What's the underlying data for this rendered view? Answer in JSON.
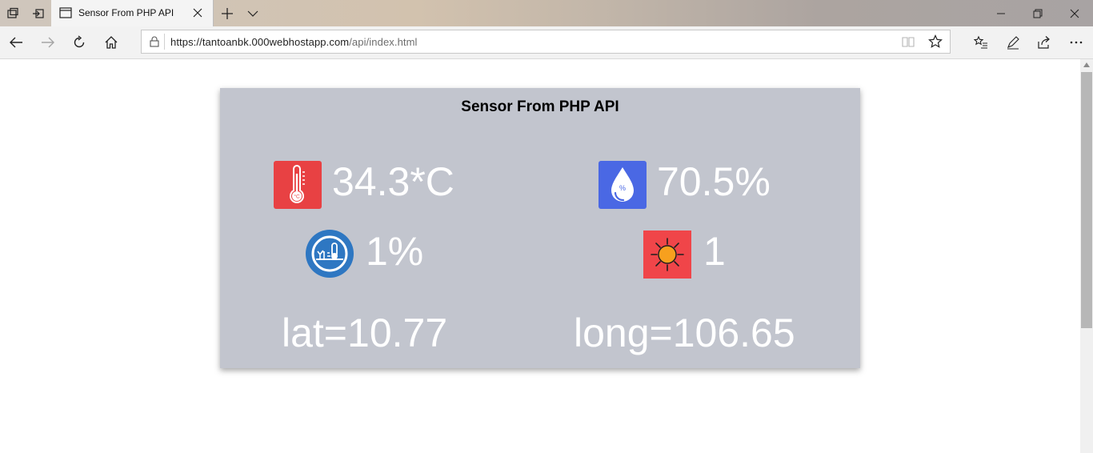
{
  "browser": {
    "tab_title": "Sensor From PHP API",
    "url_host": "https://tantoanbk.000webhostapp.com",
    "url_path": "/api/index.html"
  },
  "card": {
    "title": "Sensor From PHP API",
    "temperature": {
      "value": "34.3*C",
      "icon": "thermometer-icon",
      "icon_label": "°C",
      "icon_color": "#e84143"
    },
    "humidity": {
      "value": "70.5%",
      "icon": "water-drop-icon",
      "icon_label": "%",
      "icon_color": "#4a68e4"
    },
    "soil": {
      "value": "1%",
      "icon": "soil-moisture-icon",
      "icon_color": "#2e77c2"
    },
    "light": {
      "value": "1",
      "icon": "sun-icon",
      "icon_color": "#f04549"
    },
    "latitude": "lat=10.77",
    "longitude": "long=106.65"
  }
}
